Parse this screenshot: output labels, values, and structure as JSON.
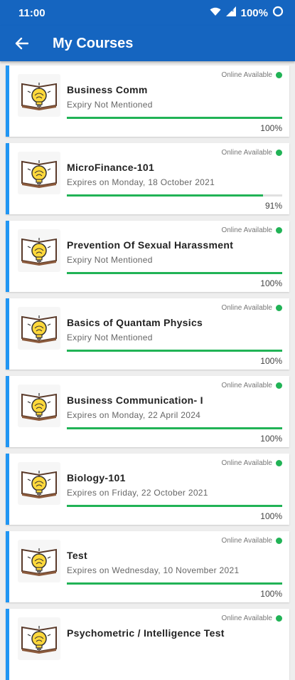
{
  "status": {
    "time": "11:00",
    "battery": "100%",
    "network": "LTE"
  },
  "header": {
    "title": "My Courses"
  },
  "courses": [
    {
      "name": "Business Comm",
      "expiry": "Expiry Not Mentioned",
      "online": "Online Available",
      "progress": "100%",
      "progress_fraction": 1.0
    },
    {
      "name": "MicroFinance-101",
      "expiry": "Expires on Monday, 18 October 2021",
      "online": "Online Available",
      "progress": "91%",
      "progress_fraction": 0.91
    },
    {
      "name": "Prevention Of Sexual Harassment",
      "expiry": "Expiry Not Mentioned",
      "online": "Online Available",
      "progress": "100%",
      "progress_fraction": 1.0
    },
    {
      "name": "Basics of Quantam Physics",
      "expiry": "Expiry Not Mentioned",
      "online": "Online Available",
      "progress": "100%",
      "progress_fraction": 1.0
    },
    {
      "name": "Business Communication- I",
      "expiry": "Expires on Monday, 22 April 2024",
      "online": "Online Available",
      "progress": "100%",
      "progress_fraction": 1.0
    },
    {
      "name": "Biology-101",
      "expiry": "Expires on Friday, 22 October 2021",
      "online": "Online Available",
      "progress": "100%",
      "progress_fraction": 1.0
    },
    {
      "name": "Test",
      "expiry": "Expires on Wednesday, 10 November 2021",
      "online": "Online Available",
      "progress": "100%",
      "progress_fraction": 1.0
    },
    {
      "name": "Psychometric / Intelligence Test",
      "online": "Online Available"
    }
  ],
  "colors": {
    "primary": "#1565c0",
    "accent": "#2196f3",
    "online": "#21b356"
  }
}
